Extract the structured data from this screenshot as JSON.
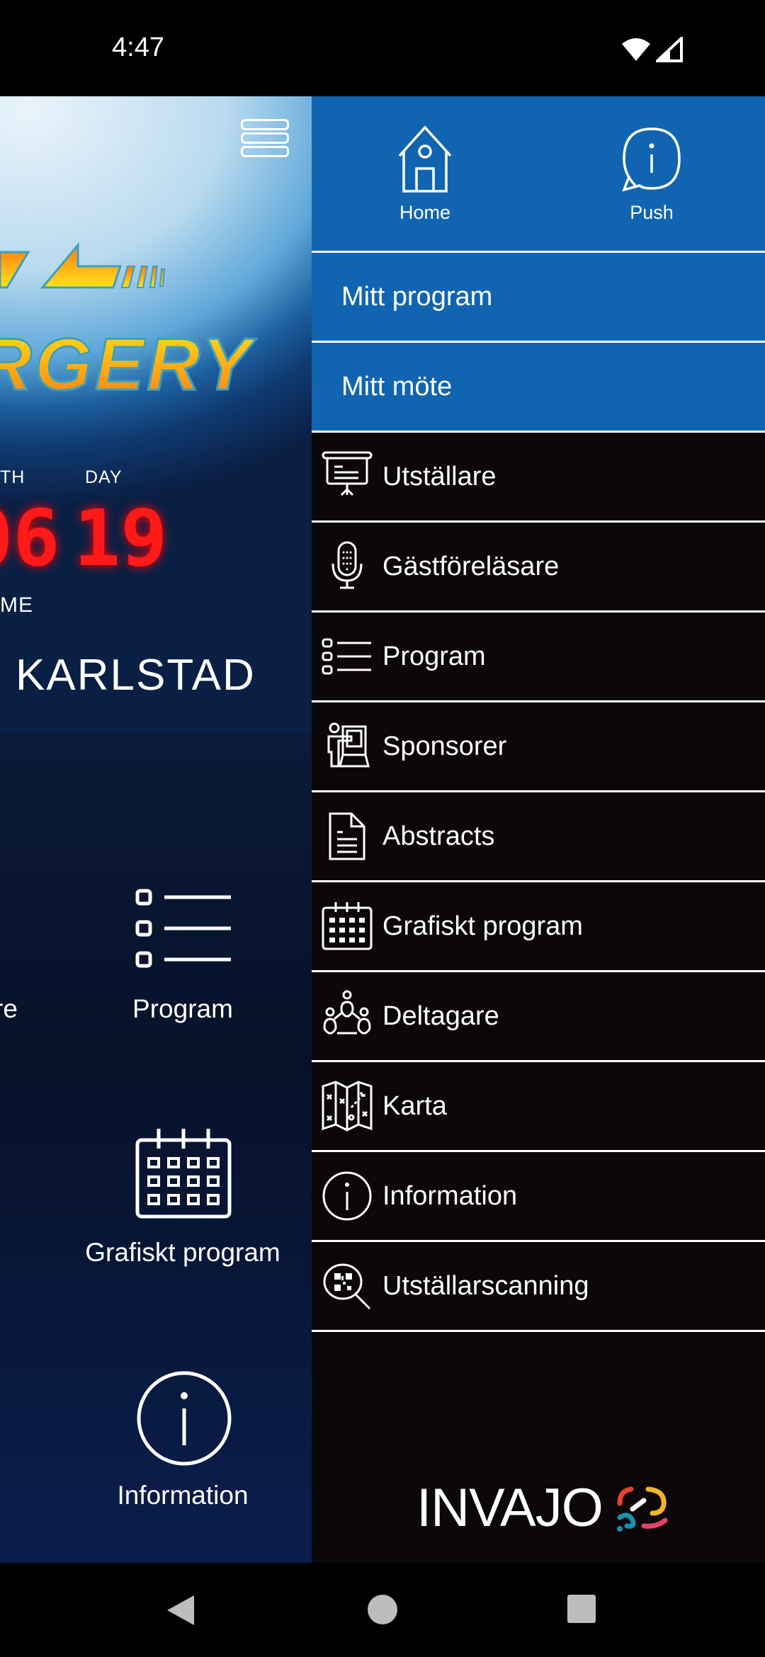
{
  "status_bar": {
    "time": "4:47",
    "icons": [
      "wifi-icon",
      "signal-icon"
    ]
  },
  "background_screen": {
    "menu_icon": "hamburger-icon",
    "logo_text": "RGERY",
    "date_labels": {
      "month": "TH",
      "day": "DAY",
      "time": "ME"
    },
    "date_digits": {
      "month": "06",
      "day": "19"
    },
    "city": "KARLSTAD",
    "tiles": [
      {
        "label": "re"
      },
      {
        "label": "Program",
        "icon": "list-icon"
      },
      {
        "label": "Grafiskt program",
        "icon": "calendar-icon"
      },
      {
        "label": "Information",
        "icon": "info-icon"
      }
    ]
  },
  "drawer": {
    "header": [
      {
        "label": "Home",
        "icon": "home-icon"
      },
      {
        "label": "Push",
        "icon": "info-chat-icon"
      }
    ],
    "items": [
      {
        "label": "Mitt program",
        "highlighted": true
      },
      {
        "label": "Mitt möte",
        "highlighted": true
      },
      {
        "label": "Utställare",
        "icon": "presentation-board-icon"
      },
      {
        "label": "Gästföreläsare",
        "icon": "microphone-icon"
      },
      {
        "label": "Program",
        "icon": "list-icon"
      },
      {
        "label": "Sponsorer",
        "icon": "presenter-icon"
      },
      {
        "label": "Abstracts",
        "icon": "document-icon"
      },
      {
        "label": "Grafiskt program",
        "icon": "calendar-icon"
      },
      {
        "label": "Deltagare",
        "icon": "people-network-icon"
      },
      {
        "label": "Karta",
        "icon": "map-icon"
      },
      {
        "label": "Information",
        "icon": "info-icon"
      },
      {
        "label": "Utställarscanning",
        "icon": "qr-scan-icon"
      }
    ],
    "brand": "INVAJO"
  },
  "colors": {
    "accent_blue": "#1165b0",
    "drawer_bg": "#0c0708",
    "digit_red": "#ff1a1a"
  },
  "nav_bar": {
    "buttons": [
      "back-icon",
      "home-icon",
      "recents-icon"
    ]
  }
}
